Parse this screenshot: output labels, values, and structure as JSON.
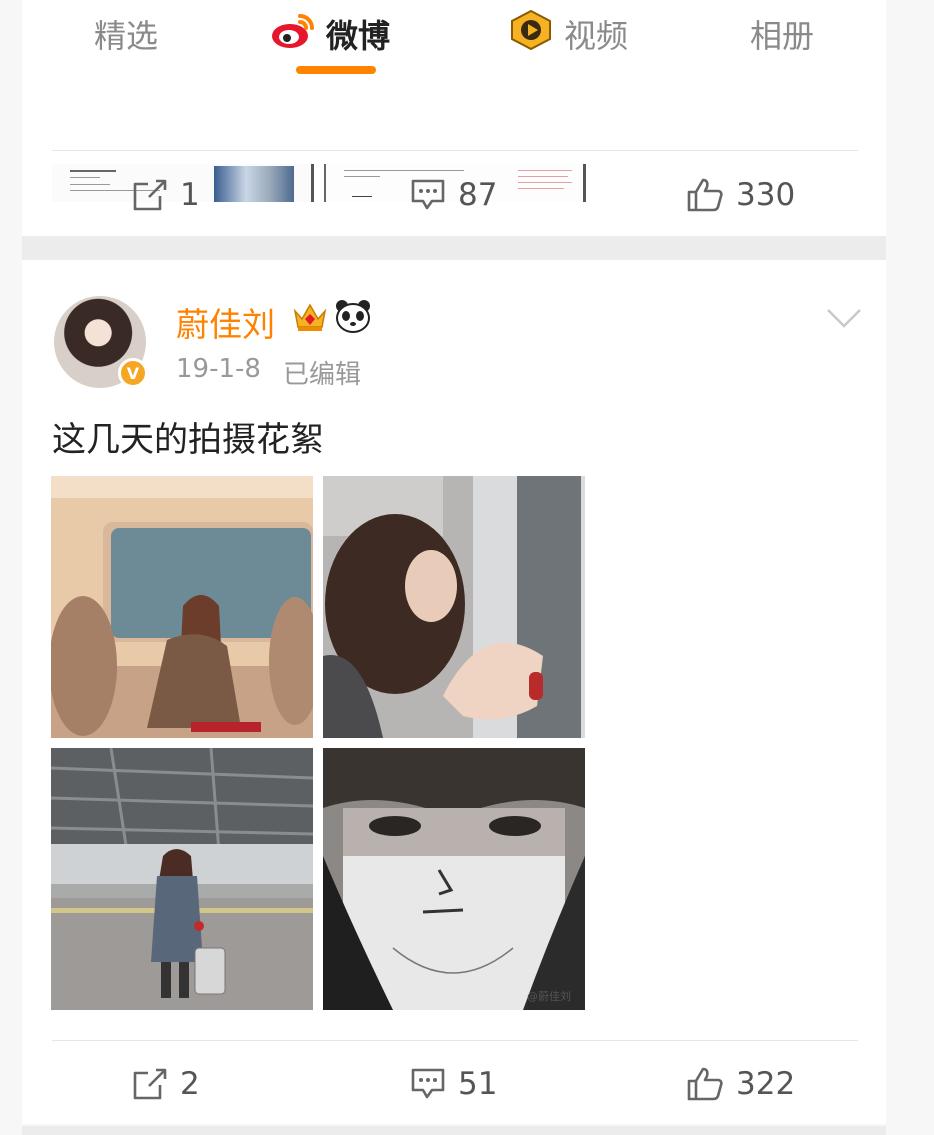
{
  "tabs": [
    {
      "label": "精选",
      "icon": ""
    },
    {
      "label": "微博",
      "icon": "weibo-logo-icon"
    },
    {
      "label": "视频",
      "icon": "play-badge-icon"
    },
    {
      "label": "相册",
      "icon": ""
    }
  ],
  "active_tab": "微博",
  "colors": {
    "accent": "#ff8200",
    "verified": "#f5a623"
  },
  "prev_post": {
    "actions": {
      "repost": "1",
      "comment": "87",
      "like": "330"
    }
  },
  "post": {
    "username": "蔚佳刘",
    "badges": [
      "crown-badge-icon",
      "panda-badge-icon"
    ],
    "verified": true,
    "date": "19-1-8",
    "edited": "已编辑",
    "text": "这几天的拍摄花絮",
    "photos": [
      {
        "name": "photo-train-seat"
      },
      {
        "name": "photo-window-profile"
      },
      {
        "name": "photo-station-platform"
      },
      {
        "name": "photo-face-sketch",
        "watermark": "@蔚佳刘"
      }
    ],
    "actions": {
      "repost": "2",
      "comment": "51",
      "like": "322"
    }
  }
}
